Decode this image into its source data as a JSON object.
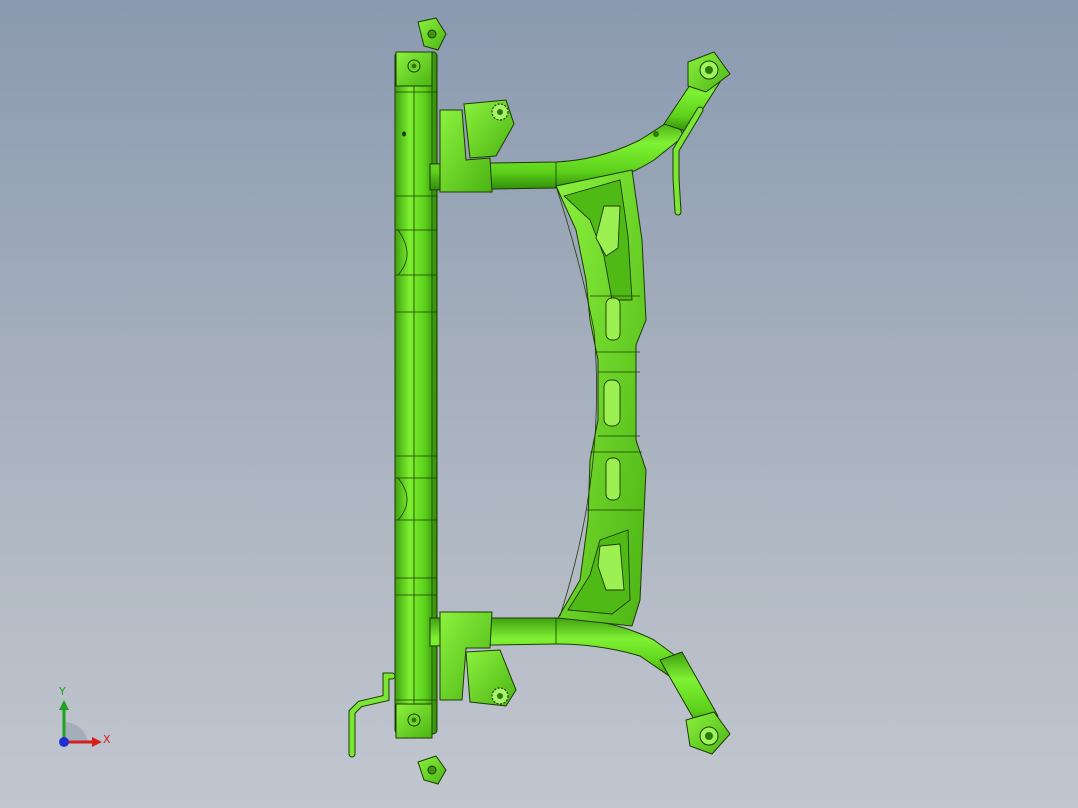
{
  "viewport": {
    "background_top": "#8a9ab0",
    "background_bottom": "#c2c7cf"
  },
  "model": {
    "name_icon": "rear-subframe-3d-model",
    "color": "#66e01e",
    "edge_color": "#1e3a06"
  },
  "triad": {
    "x_label": "X",
    "y_label": "Y",
    "x_color": "#d42020",
    "y_color": "#1fa21f",
    "z_color": "#2030d0"
  }
}
